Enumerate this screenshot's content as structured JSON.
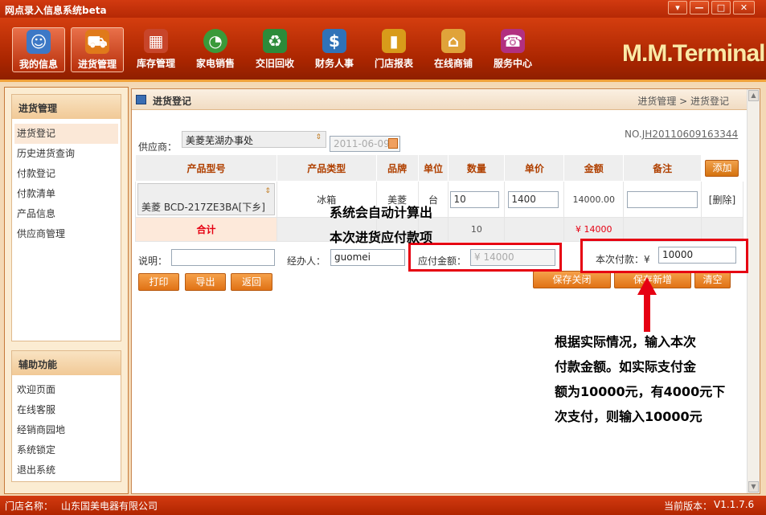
{
  "window": {
    "title": "网点录入信息系统beta",
    "btn_menu": "▾",
    "btn_min": "—",
    "btn_max": "□",
    "btn_close": "✕"
  },
  "nav": {
    "items": [
      {
        "label": "我的信息",
        "icon": "user-icon",
        "color": "#3d78c6"
      },
      {
        "label": "进货管理",
        "icon": "cart-icon",
        "color": "#e07a1a"
      },
      {
        "label": "库存管理",
        "icon": "boxes-icon",
        "color": "#c8452a"
      },
      {
        "label": "家电销售",
        "icon": "pie-chart-icon",
        "color": "#3a9a3a"
      },
      {
        "label": "交旧回收",
        "icon": "recycle-icon",
        "color": "#2d8b3a"
      },
      {
        "label": "财务人事",
        "icon": "money-icon",
        "color": "#3072b8"
      },
      {
        "label": "门店报表",
        "icon": "bar-chart-icon",
        "color": "#d89b1a"
      },
      {
        "label": "在线商铺",
        "icon": "house-icon",
        "color": "#e0a33a"
      },
      {
        "label": "服务中心",
        "icon": "service-icon",
        "color": "#b23080"
      }
    ],
    "brand": "M.M.Terminal"
  },
  "sidebar": {
    "group1": {
      "title": "进货管理",
      "items": [
        "进货登记",
        "历史进货查询",
        "付款登记",
        "付款清单",
        "产品信息",
        "供应商管理"
      ]
    },
    "group2": {
      "title": "辅助功能",
      "items": [
        "欢迎页面",
        "在线客服",
        "经销商园地",
        "系统锁定",
        "退出系统"
      ]
    }
  },
  "main": {
    "title": "进货登记",
    "breadcrumb": "进货管理 > 进货登记",
    "supplier_label": "供应商：",
    "supplier_value": "美菱芜湖办事处",
    "date_value": "2011-06-09",
    "order_no_prefix": "NO.",
    "order_no": "JH20110609163344",
    "columns": [
      "产品型号",
      "产品类型",
      "品牌",
      "单位",
      "数量",
      "单价",
      "金额",
      "备注"
    ],
    "add_button": "添加",
    "row": {
      "model": "美菱 BCD-217ZE3BA[下乡]",
      "type": "冰箱",
      "brand": "美菱",
      "unit": "台",
      "qty": "10",
      "price": "1400",
      "amount": "14000.00",
      "remark": "",
      "delete": "[删除]"
    },
    "total": {
      "label": "合计",
      "qty": "10",
      "amount": "¥ 14000"
    },
    "desc_label": "说明：",
    "desc_value": "",
    "handler_label": "经办人：",
    "handler_value": "guomei",
    "payable_label": "应付金额：",
    "payable_value": "¥ 14000",
    "pay_label": "本次付款：¥",
    "pay_value": "10000",
    "buttons": {
      "print": "打印",
      "export": "导出",
      "back": "返回",
      "save_close": "保存关闭",
      "save_new": "保存新增",
      "clear": "清空"
    }
  },
  "annotations": {
    "note1_line1": "系统会自动计算出",
    "note1_line2": "本次进货应付款项",
    "note2_lines": [
      "根据实际情况，输入本次",
      "付款金额。如实际支付金",
      "额为10000元，有4000元下",
      "次支付，则输入10000元"
    ]
  },
  "status": {
    "shop_label": "门店名称：",
    "shop_name": "山东国美电器有限公司",
    "version_label": "当前版本：",
    "version": "V1.1.7.6"
  }
}
